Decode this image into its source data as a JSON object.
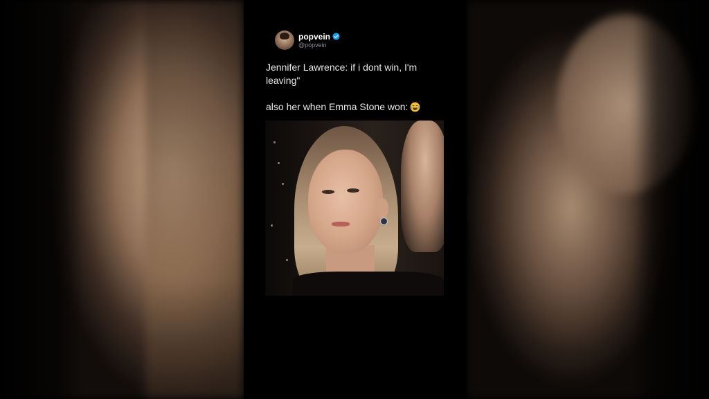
{
  "tweet": {
    "display_name": "popvein",
    "handle": "@popvein",
    "line1": "Jennifer Lawrence: if i dont win, I'm leaving\"",
    "line2": "also her when Emma Stone won:",
    "emoji": "face-with-tears-of-joy-emoji",
    "verified_icon": "verified-badge-icon",
    "verified_color": "#1d9bf0"
  },
  "colors": {
    "background": "#000000",
    "text": "#e8e8e8",
    "handle": "#8b8f94"
  }
}
